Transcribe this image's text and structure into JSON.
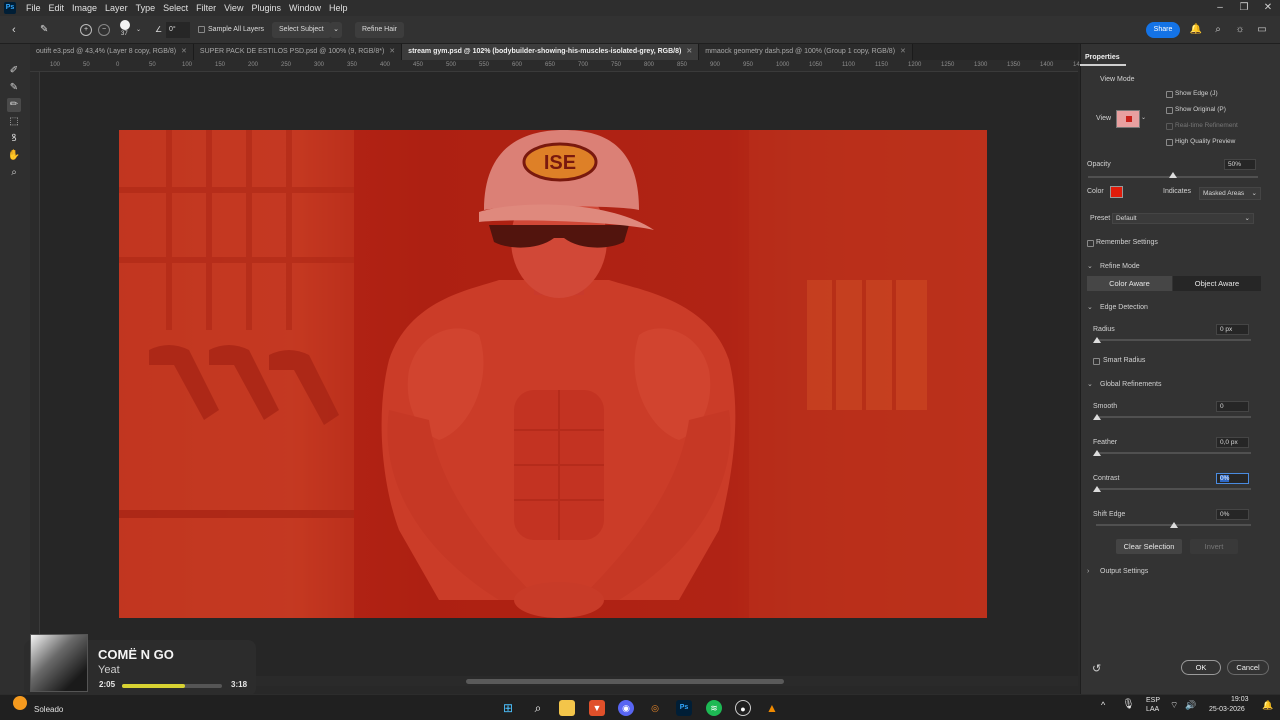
{
  "menubar": {
    "items": [
      "File",
      "Edit",
      "Image",
      "Layer",
      "Type",
      "Select",
      "Filter",
      "View",
      "Plugins",
      "Window",
      "Help"
    ],
    "app_icon": "Ps"
  },
  "options": {
    "brush_size": "37",
    "angle": "0°",
    "sample_all_layers": "Sample All Layers",
    "select_subject": "Select Subject",
    "refine_hair": "Refine Hair",
    "share": "Share"
  },
  "tabs": [
    {
      "label": "outift e3.psd @ 43,4% (Layer 8 copy, RGB/8)",
      "active": false
    },
    {
      "label": "SUPER PACK DE ESTILOS PSD.psd @ 100% (9, RGB/8*)",
      "active": false
    },
    {
      "label": "stream gym.psd @ 102% (bodybuilder-showing-his-muscles-isolated-grey, RGB/8)",
      "active": true
    },
    {
      "label": "mmaock geometry dash.psd @ 100% (Group 1 copy, RGB/8)",
      "active": false
    }
  ],
  "ruler": {
    "h_ticks": [
      "100",
      "50",
      "0",
      "50",
      "100",
      "150",
      "200",
      "250",
      "300",
      "350",
      "400",
      "450",
      "500",
      "550",
      "600",
      "650",
      "700",
      "750",
      "800",
      "850",
      "900",
      "950",
      "1000",
      "1050",
      "1100",
      "1150",
      "1200",
      "1250",
      "1300",
      "1350",
      "1400",
      "1450",
      "1500",
      "1550"
    ]
  },
  "canvas": {
    "cap_text": "ISE"
  },
  "properties": {
    "title": "Properties",
    "view_mode": "View Mode",
    "view_label": "View",
    "show_edge": "Show Edge (J)",
    "show_original": "Show Original (P)",
    "real_time": "Real-time Refinement",
    "high_quality": "High Quality Preview",
    "opacity_label": "Opacity",
    "opacity_value": "50%",
    "opacity_fraction": 0.5,
    "color_label": "Color",
    "overlay_color": "#e01b0a",
    "indicates_label": "Indicates",
    "indicates_value": "Masked Areas",
    "preset_label": "Preset",
    "preset_value": "Default",
    "remember_settings": "Remember Settings",
    "refine_mode": "Refine Mode",
    "color_aware": "Color Aware",
    "object_aware": "Object Aware",
    "edge_detection": "Edge Detection",
    "radius_label": "Radius",
    "radius_value": "0 px",
    "smart_radius": "Smart Radius",
    "global_refinements": "Global Refinements",
    "smooth_label": "Smooth",
    "smooth_value": "0",
    "feather_label": "Feather",
    "feather_value": "0,0 px",
    "contrast_label": "Contrast",
    "contrast_value": "0%",
    "shift_edge_label": "Shift Edge",
    "shift_edge_value": "0%",
    "clear_selection": "Clear Selection",
    "invert": "Invert",
    "output_settings": "Output Settings",
    "ok": "OK",
    "cancel": "Cancel"
  },
  "media": {
    "title": "COMË N GO",
    "artist": "Yeat",
    "current_time": "2:05",
    "total_time": "3:18",
    "progress": 0.63
  },
  "taskbar": {
    "weather": "Soleado",
    "lang_top": "ESP",
    "lang_bottom": "LAA",
    "time": "19:03",
    "date": "25-03-2026"
  }
}
